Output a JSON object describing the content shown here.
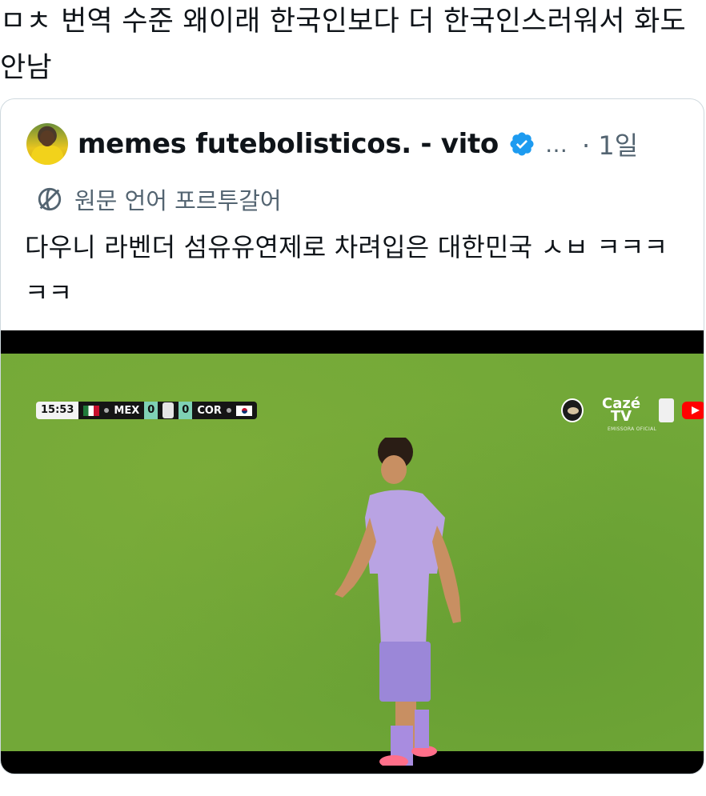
{
  "post": {
    "text": "ㅁㅊ 번역 수준 왜이래 한국인보다 더 한국인스러워서 화도 안남"
  },
  "quote": {
    "author_name": "memes futebolisticos. - vito",
    "verified_icon": "verified-badge-icon",
    "more": "…",
    "time": "· 1일",
    "translated_label": "원문 언어 포르투갈어",
    "body": "다우니 라벤더 섬유유연제로 차려입은 대한민국 ㅅㅂ ㅋㅋㅋㅋㅋ"
  },
  "video": {
    "scoreboard": {
      "clock": "15:53",
      "home_team": "MEX",
      "home_score": "0",
      "away_score": "0",
      "away_team": "COR"
    },
    "broadcaster": {
      "logo_text": "Cazé TV",
      "subtitle": "EMISSORA OFICIAL"
    }
  },
  "colors": {
    "accent_blue": "#1d9bf0",
    "text_gray": "#536471",
    "pitch_green": "#72a838",
    "kit_lavender": "#b9a3e3"
  }
}
